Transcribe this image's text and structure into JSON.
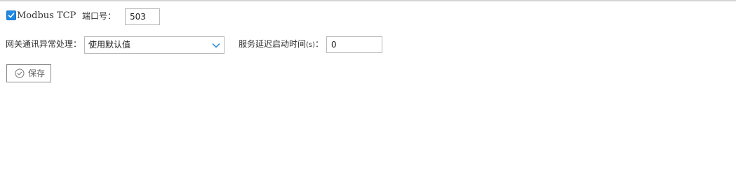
{
  "protocol": {
    "checkbox_label": "Modbus TCP",
    "checked": true
  },
  "port": {
    "label": "端口号：",
    "value": "503"
  },
  "gateway_error": {
    "label": "网关通讯异常处理：",
    "selected": "使用默认值"
  },
  "service_delay": {
    "label": "服务延迟启动时间",
    "unit": "(s)",
    "colon": "：",
    "value": "0"
  },
  "actions": {
    "save_label": "保存"
  },
  "icons": {
    "checkbox": "checkmark-icon",
    "dropdown": "chevron-down-icon",
    "save": "check-circle-icon"
  },
  "colors": {
    "accent": "#1e88e5",
    "border": "#b8b8b8",
    "button_border": "#8a8a8a"
  }
}
